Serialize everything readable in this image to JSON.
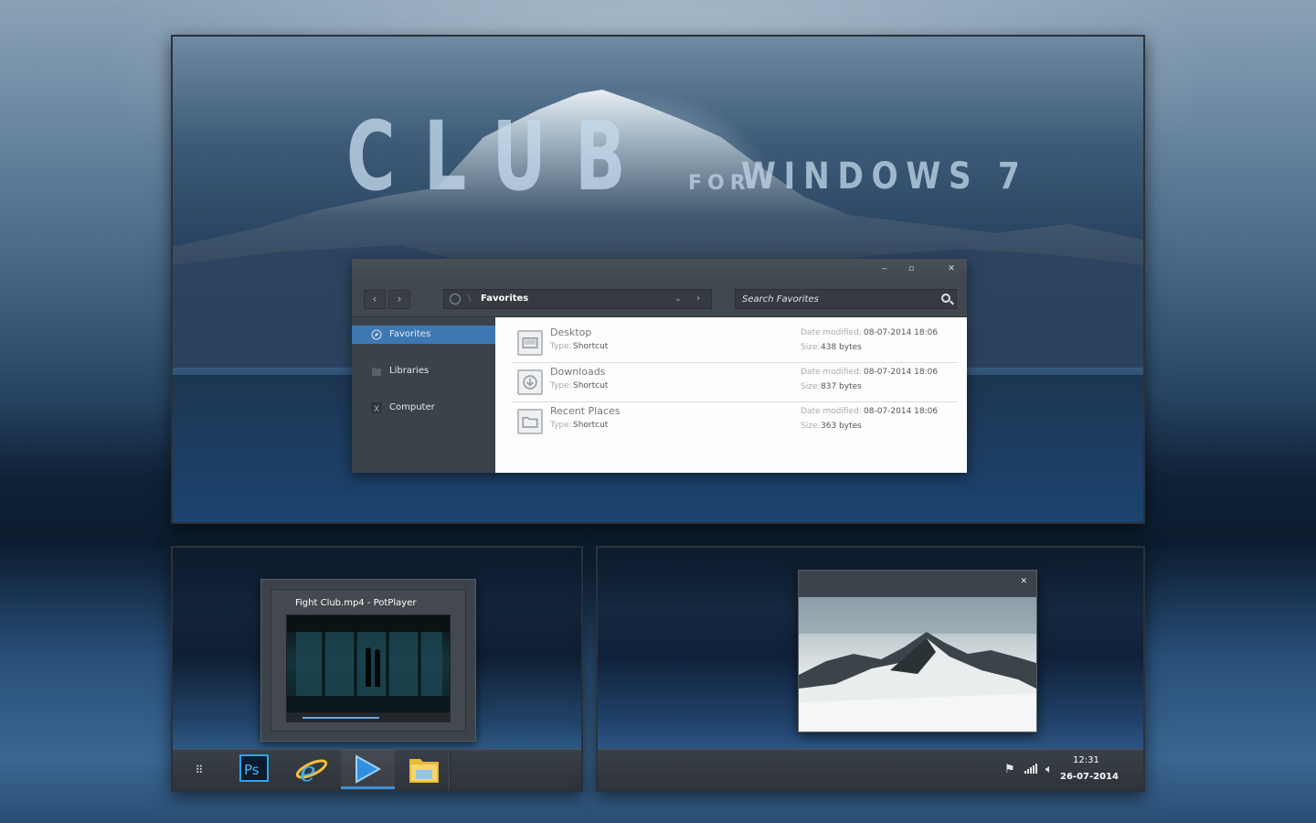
{
  "hero": {
    "title": "CLUB",
    "for": "FOR",
    "os": "WINDOWS 7"
  },
  "explorer": {
    "title_buttons": {
      "minimize": "‒",
      "maximize": "▫",
      "close": "✕"
    },
    "address": "Favorites",
    "search_placeholder": "Search Favorites",
    "sidebar": [
      {
        "label": "Favorites",
        "icon": "compass-icon",
        "active": true
      },
      {
        "label": "Libraries",
        "icon": "folder-icon",
        "active": false
      },
      {
        "label": "Computer",
        "icon": "computer-icon",
        "active": false
      }
    ],
    "files": [
      {
        "name": "Desktop",
        "type_label": "Type:",
        "type": "Shortcut",
        "date_label": "Date modified:",
        "date": "08-07-2014 18:06",
        "size_label": "Size:",
        "size": "438 bytes",
        "icon": "desktop-icon"
      },
      {
        "name": "Downloads",
        "type_label": "Type:",
        "type": "Shortcut",
        "date_label": "Date modified:",
        "date": "08-07-2014 18:06",
        "size_label": "Size:",
        "size": "837 bytes",
        "icon": "download-icon"
      },
      {
        "name": "Recent Places",
        "type_label": "Type:",
        "type": "Shortcut",
        "date_label": "Date modified:",
        "date": "08-07-2014 18:06",
        "size_label": "Size:",
        "size": "363 bytes",
        "icon": "folder-icon"
      }
    ]
  },
  "preview": {
    "title": "Fight Club.mp4 - PotPlayer"
  },
  "taskbar_left": {
    "start_glyph": "⠿",
    "apps": [
      {
        "name": "photoshop",
        "label": "Ps",
        "active": false
      },
      {
        "name": "internet-explorer",
        "label": "e",
        "active": false
      },
      {
        "name": "potplayer",
        "label": "▶",
        "active": true
      },
      {
        "name": "file-explorer",
        "label": "",
        "active": false
      }
    ]
  },
  "photo_popup": {
    "close": "✕"
  },
  "tray": {
    "time": "12:31",
    "date": "26-07-2014"
  },
  "colors": {
    "accent": "#3e78b3",
    "taskbar_indicator": "#3a8fd6",
    "explorer_bg": "#3c4249"
  }
}
